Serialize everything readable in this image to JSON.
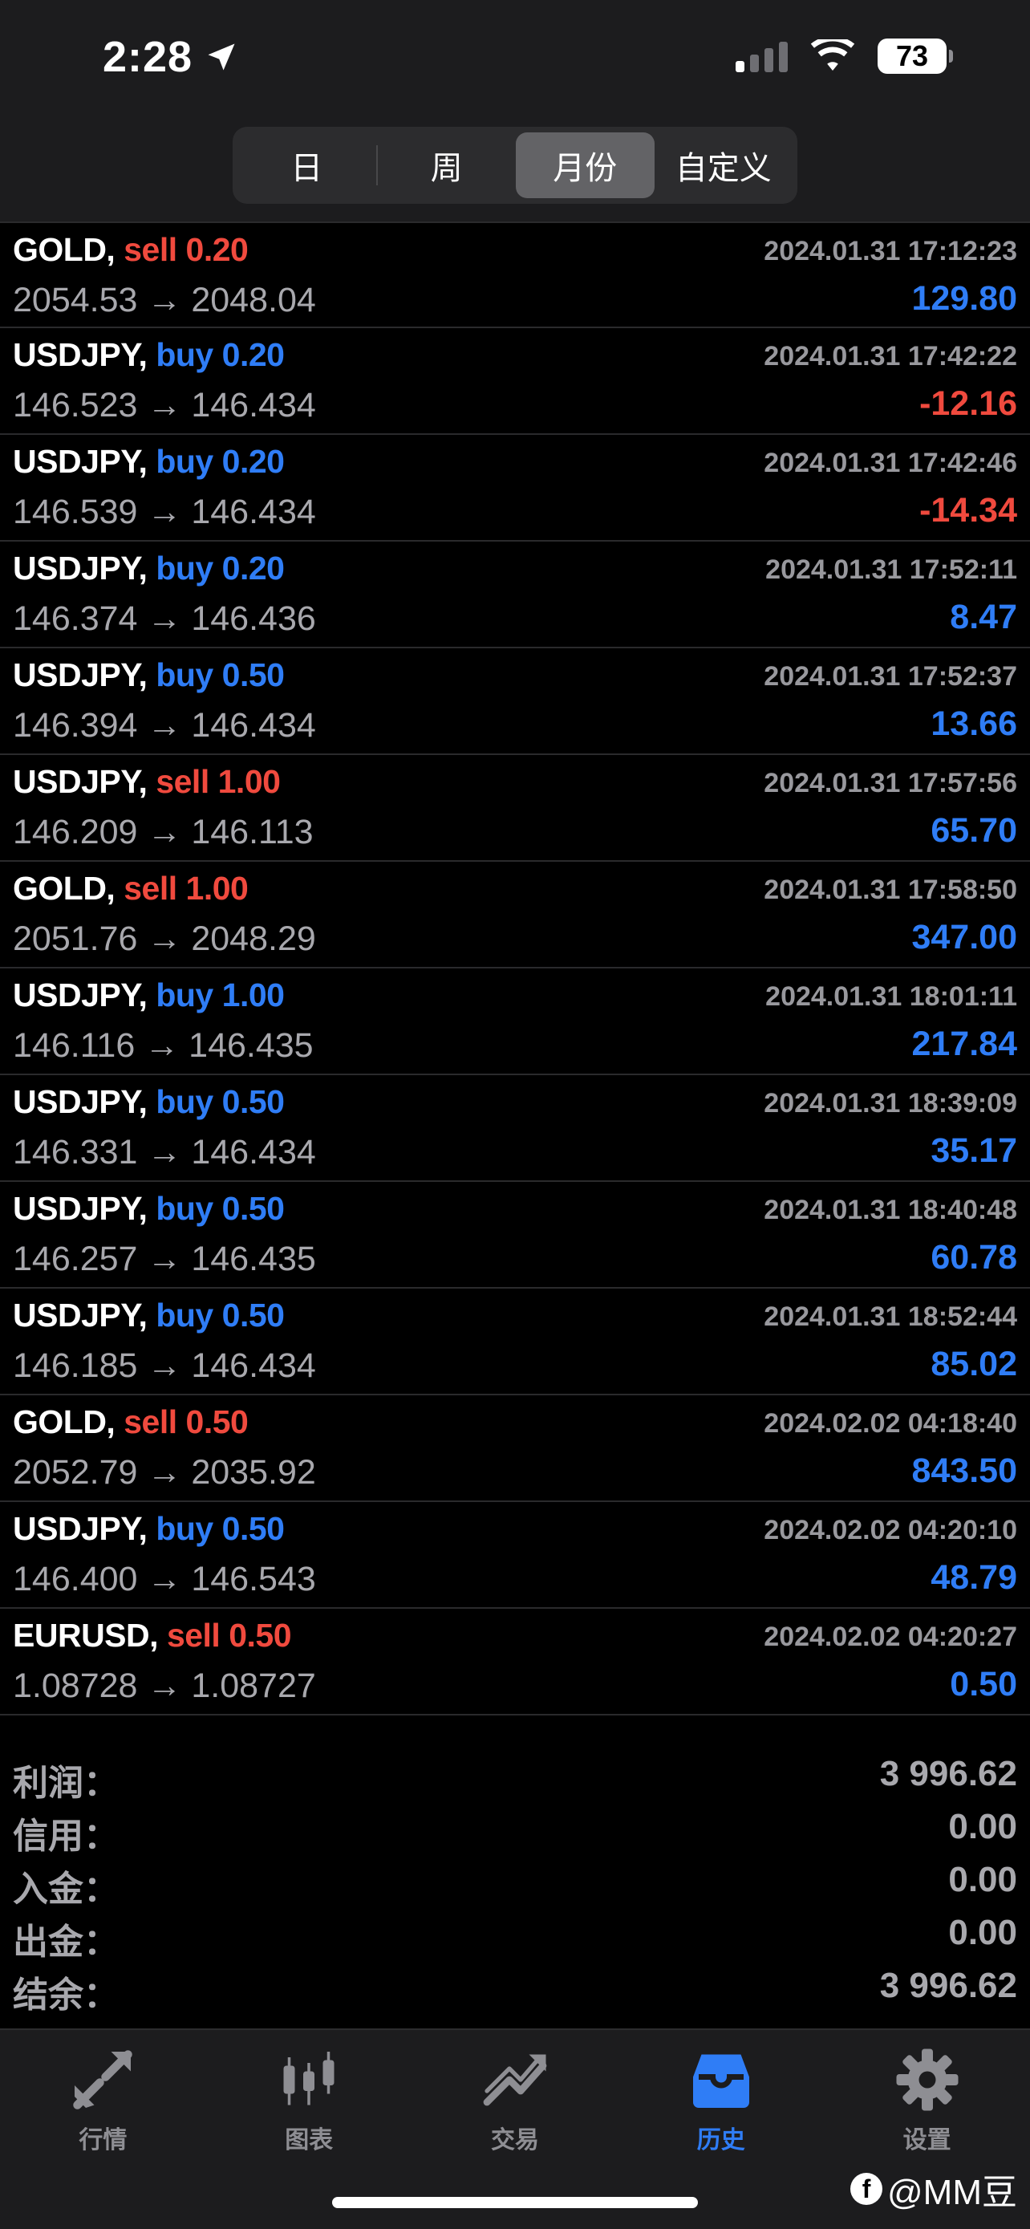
{
  "status_bar": {
    "time": "2:28",
    "battery": "73"
  },
  "segments": [
    {
      "label": "日",
      "active": false
    },
    {
      "label": "周",
      "active": false
    },
    {
      "label": "月份",
      "active": true
    },
    {
      "label": "自定义",
      "active": false
    }
  ],
  "trades": [
    {
      "symbol": "GOLD,",
      "side": "sell",
      "volume": "0.20",
      "datetime": "2024.01.31 17:12:23",
      "open": "2054.53",
      "close": "2048.04",
      "profit": "129.80",
      "profit_sign": "pos"
    },
    {
      "symbol": "USDJPY,",
      "side": "buy",
      "volume": "0.20",
      "datetime": "2024.01.31 17:42:22",
      "open": "146.523",
      "close": "146.434",
      "profit": "-12.16",
      "profit_sign": "neg"
    },
    {
      "symbol": "USDJPY,",
      "side": "buy",
      "volume": "0.20",
      "datetime": "2024.01.31 17:42:46",
      "open": "146.539",
      "close": "146.434",
      "profit": "-14.34",
      "profit_sign": "neg"
    },
    {
      "symbol": "USDJPY,",
      "side": "buy",
      "volume": "0.20",
      "datetime": "2024.01.31 17:52:11",
      "open": "146.374",
      "close": "146.436",
      "profit": "8.47",
      "profit_sign": "pos"
    },
    {
      "symbol": "USDJPY,",
      "side": "buy",
      "volume": "0.50",
      "datetime": "2024.01.31 17:52:37",
      "open": "146.394",
      "close": "146.434",
      "profit": "13.66",
      "profit_sign": "pos"
    },
    {
      "symbol": "USDJPY,",
      "side": "sell",
      "volume": "1.00",
      "datetime": "2024.01.31 17:57:56",
      "open": "146.209",
      "close": "146.113",
      "profit": "65.70",
      "profit_sign": "pos"
    },
    {
      "symbol": "GOLD,",
      "side": "sell",
      "volume": "1.00",
      "datetime": "2024.01.31 17:58:50",
      "open": "2051.76",
      "close": "2048.29",
      "profit": "347.00",
      "profit_sign": "pos"
    },
    {
      "symbol": "USDJPY,",
      "side": "buy",
      "volume": "1.00",
      "datetime": "2024.01.31 18:01:11",
      "open": "146.116",
      "close": "146.435",
      "profit": "217.84",
      "profit_sign": "pos"
    },
    {
      "symbol": "USDJPY,",
      "side": "buy",
      "volume": "0.50",
      "datetime": "2024.01.31 18:39:09",
      "open": "146.331",
      "close": "146.434",
      "profit": "35.17",
      "profit_sign": "pos"
    },
    {
      "symbol": "USDJPY,",
      "side": "buy",
      "volume": "0.50",
      "datetime": "2024.01.31 18:40:48",
      "open": "146.257",
      "close": "146.435",
      "profit": "60.78",
      "profit_sign": "pos"
    },
    {
      "symbol": "USDJPY,",
      "side": "buy",
      "volume": "0.50",
      "datetime": "2024.01.31 18:52:44",
      "open": "146.185",
      "close": "146.434",
      "profit": "85.02",
      "profit_sign": "pos"
    },
    {
      "symbol": "GOLD,",
      "side": "sell",
      "volume": "0.50",
      "datetime": "2024.02.02 04:18:40",
      "open": "2052.79",
      "close": "2035.92",
      "profit": "843.50",
      "profit_sign": "pos"
    },
    {
      "symbol": "USDJPY,",
      "side": "buy",
      "volume": "0.50",
      "datetime": "2024.02.02 04:20:10",
      "open": "146.400",
      "close": "146.543",
      "profit": "48.79",
      "profit_sign": "pos"
    },
    {
      "symbol": "EURUSD,",
      "side": "sell",
      "volume": "0.50",
      "datetime": "2024.02.02 04:20:27",
      "open": "1.08728",
      "close": "1.08727",
      "profit": "0.50",
      "profit_sign": "pos"
    }
  ],
  "arrow": "→",
  "summary": [
    {
      "label": "利润：",
      "value": "3 996.62"
    },
    {
      "label": "信用：",
      "value": "0.00"
    },
    {
      "label": "入金：",
      "value": "0.00"
    },
    {
      "label": "出金：",
      "value": "0.00"
    },
    {
      "label": "结余：",
      "value": "3 996.62"
    }
  ],
  "tabbar": [
    {
      "label": "行情",
      "icon": "quotes-arrows-icon",
      "active": false
    },
    {
      "label": "图表",
      "icon": "candlestick-chart-icon",
      "active": false
    },
    {
      "label": "交易",
      "icon": "trade-trend-icon",
      "active": false
    },
    {
      "label": "历史",
      "icon": "history-inbox-icon",
      "active": true
    },
    {
      "label": "设置",
      "icon": "gear-icon",
      "active": false
    }
  ],
  "watermark": "@MM豆",
  "colors": {
    "sell": "#f04a3e",
    "buy": "#2f7df6",
    "negative": "#f04a3e",
    "positive": "#2f7df6",
    "active_tab": "#2f7df6"
  }
}
